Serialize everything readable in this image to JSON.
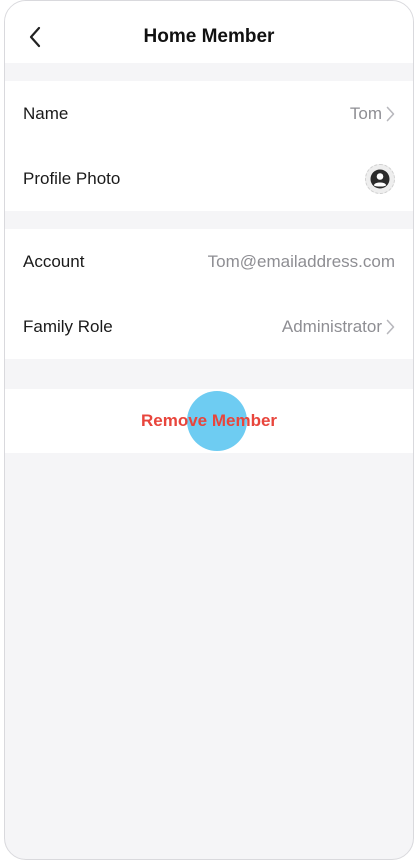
{
  "header": {
    "title": "Home Member"
  },
  "profile": {
    "name_label": "Name",
    "name_value": "Tom",
    "photo_label": "Profile Photo"
  },
  "account": {
    "account_label": "Account",
    "account_value": "Tom@emailaddress.com",
    "role_label": "Family Role",
    "role_value": "Administrator"
  },
  "actions": {
    "remove_label": "Remove Member",
    "remove_color": "#e8453c"
  },
  "icons": {
    "back": "chevron-left-icon",
    "row_chevron": "chevron-right-icon",
    "avatar": "person-icon"
  }
}
